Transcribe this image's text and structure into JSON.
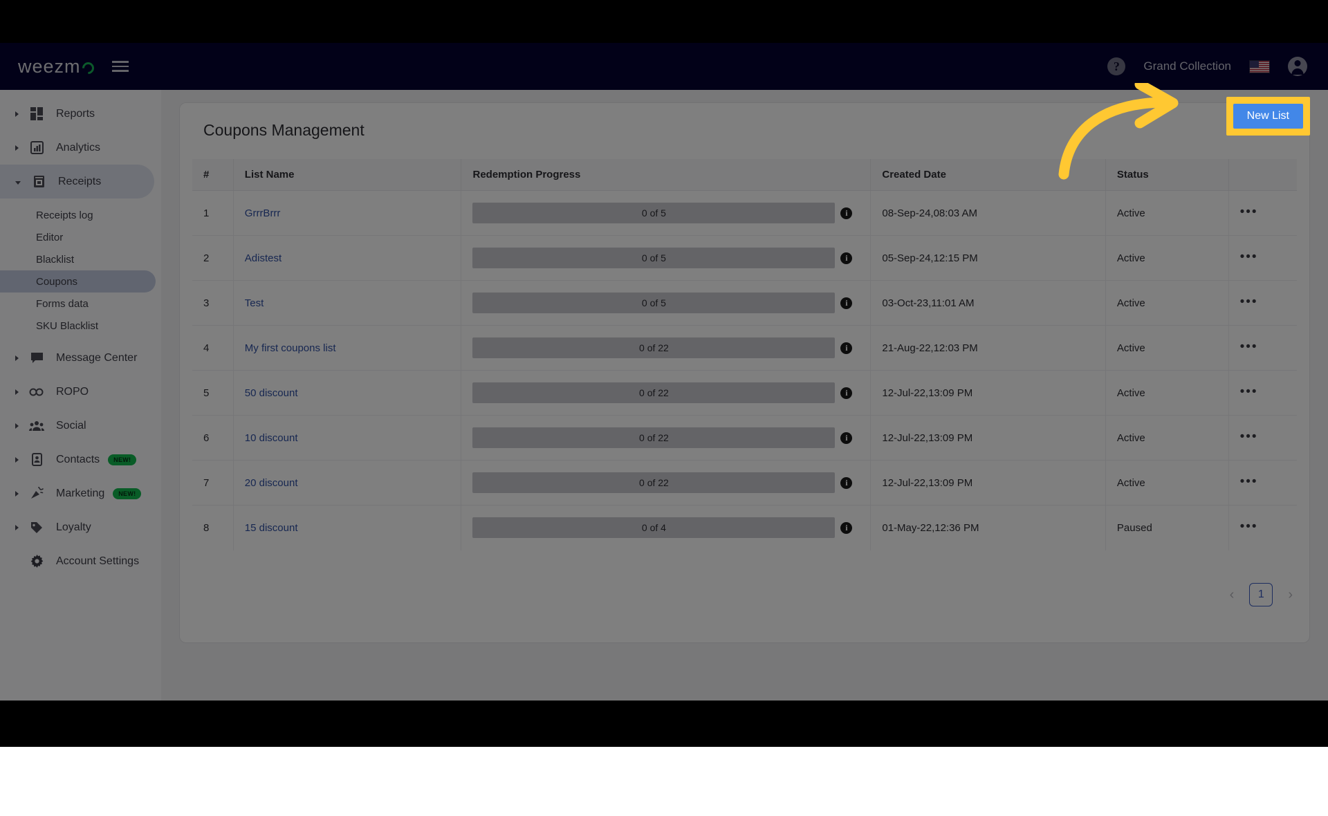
{
  "navbar": {
    "logo_text": "weezm",
    "logo_icon": "weezmo-logo-circle",
    "menu_icon": "hamburger-menu-icon",
    "help_icon": "help-question-icon",
    "account_name": "Grand Collection",
    "flag_icon": "us-flag-icon",
    "avatar_icon": "account-avatar-icon"
  },
  "sidebar": {
    "items": [
      {
        "label": "Reports",
        "icon": "dashboard-grid-icon",
        "expandable": true,
        "expanded": false,
        "badge": ""
      },
      {
        "label": "Analytics",
        "icon": "bar-chart-icon",
        "expandable": true,
        "expanded": false,
        "badge": ""
      },
      {
        "label": "Receipts",
        "icon": "receipt-icon",
        "expandable": true,
        "expanded": true,
        "badge": ""
      },
      {
        "label": "Message Center",
        "icon": "chat-bubble-icon",
        "expandable": true,
        "expanded": false,
        "badge": ""
      },
      {
        "label": "ROPO",
        "icon": "infinity-icon",
        "expandable": true,
        "expanded": false,
        "badge": ""
      },
      {
        "label": "Social",
        "icon": "people-group-icon",
        "expandable": true,
        "expanded": false,
        "badge": ""
      },
      {
        "label": "Contacts",
        "icon": "contact-card-icon",
        "expandable": true,
        "expanded": false,
        "badge": "NEW!"
      },
      {
        "label": "Marketing",
        "icon": "megaphone-icon",
        "expandable": true,
        "expanded": false,
        "badge": "NEW!"
      },
      {
        "label": "Loyalty",
        "icon": "price-tag-icon",
        "expandable": true,
        "expanded": false,
        "badge": ""
      },
      {
        "label": "Account Settings",
        "icon": "gear-icon",
        "expandable": false,
        "expanded": false,
        "badge": ""
      }
    ],
    "receipts_subitems": [
      {
        "label": "Receipts log",
        "selected": false
      },
      {
        "label": "Editor",
        "selected": false
      },
      {
        "label": "Blacklist",
        "selected": false
      },
      {
        "label": "Coupons",
        "selected": true
      },
      {
        "label": "Forms data",
        "selected": false
      },
      {
        "label": "SKU Blacklist",
        "selected": false
      }
    ],
    "badge_color": "#12b84e"
  },
  "main": {
    "page_title": "Coupons Management",
    "new_list_label": "New List",
    "new_list_color": "#4287e8",
    "highlight_color": "#ffc832",
    "columns": [
      "#",
      "List Name",
      "Redemption Progress",
      "Created Date",
      "Status",
      ""
    ],
    "rows": [
      {
        "num": "1",
        "name": "GrrrBrrr",
        "progress": "0 of 5",
        "date": "08-Sep-24,08:03 AM",
        "status": "Active",
        "menu": "•••"
      },
      {
        "num": "2",
        "name": "Adistest",
        "progress": "0 of 5",
        "date": "05-Sep-24,12:15 PM",
        "status": "Active",
        "menu": "•••"
      },
      {
        "num": "3",
        "name": "Test",
        "progress": "0 of 5",
        "date": "03-Oct-23,11:01 AM",
        "status": "Active",
        "menu": "•••"
      },
      {
        "num": "4",
        "name": "My first coupons list",
        "progress": "0 of 22",
        "date": "21-Aug-22,12:03 PM",
        "status": "Active",
        "menu": "•••"
      },
      {
        "num": "5",
        "name": "50 discount",
        "progress": "0 of 22",
        "date": "12-Jul-22,13:09 PM",
        "status": "Active",
        "menu": "•••"
      },
      {
        "num": "6",
        "name": "10 discount",
        "progress": "0 of 22",
        "date": "12-Jul-22,13:09 PM",
        "status": "Active",
        "menu": "•••"
      },
      {
        "num": "7",
        "name": "20 discount",
        "progress": "0 of 22",
        "date": "12-Jul-22,13:09 PM",
        "status": "Active",
        "menu": "•••"
      },
      {
        "num": "8",
        "name": "15 discount",
        "progress": "0 of 4",
        "date": "01-May-22,12:36 PM",
        "status": "Paused",
        "menu": "•••"
      }
    ],
    "pagination": {
      "prev": "‹",
      "current_page": "1",
      "next": "›"
    }
  }
}
